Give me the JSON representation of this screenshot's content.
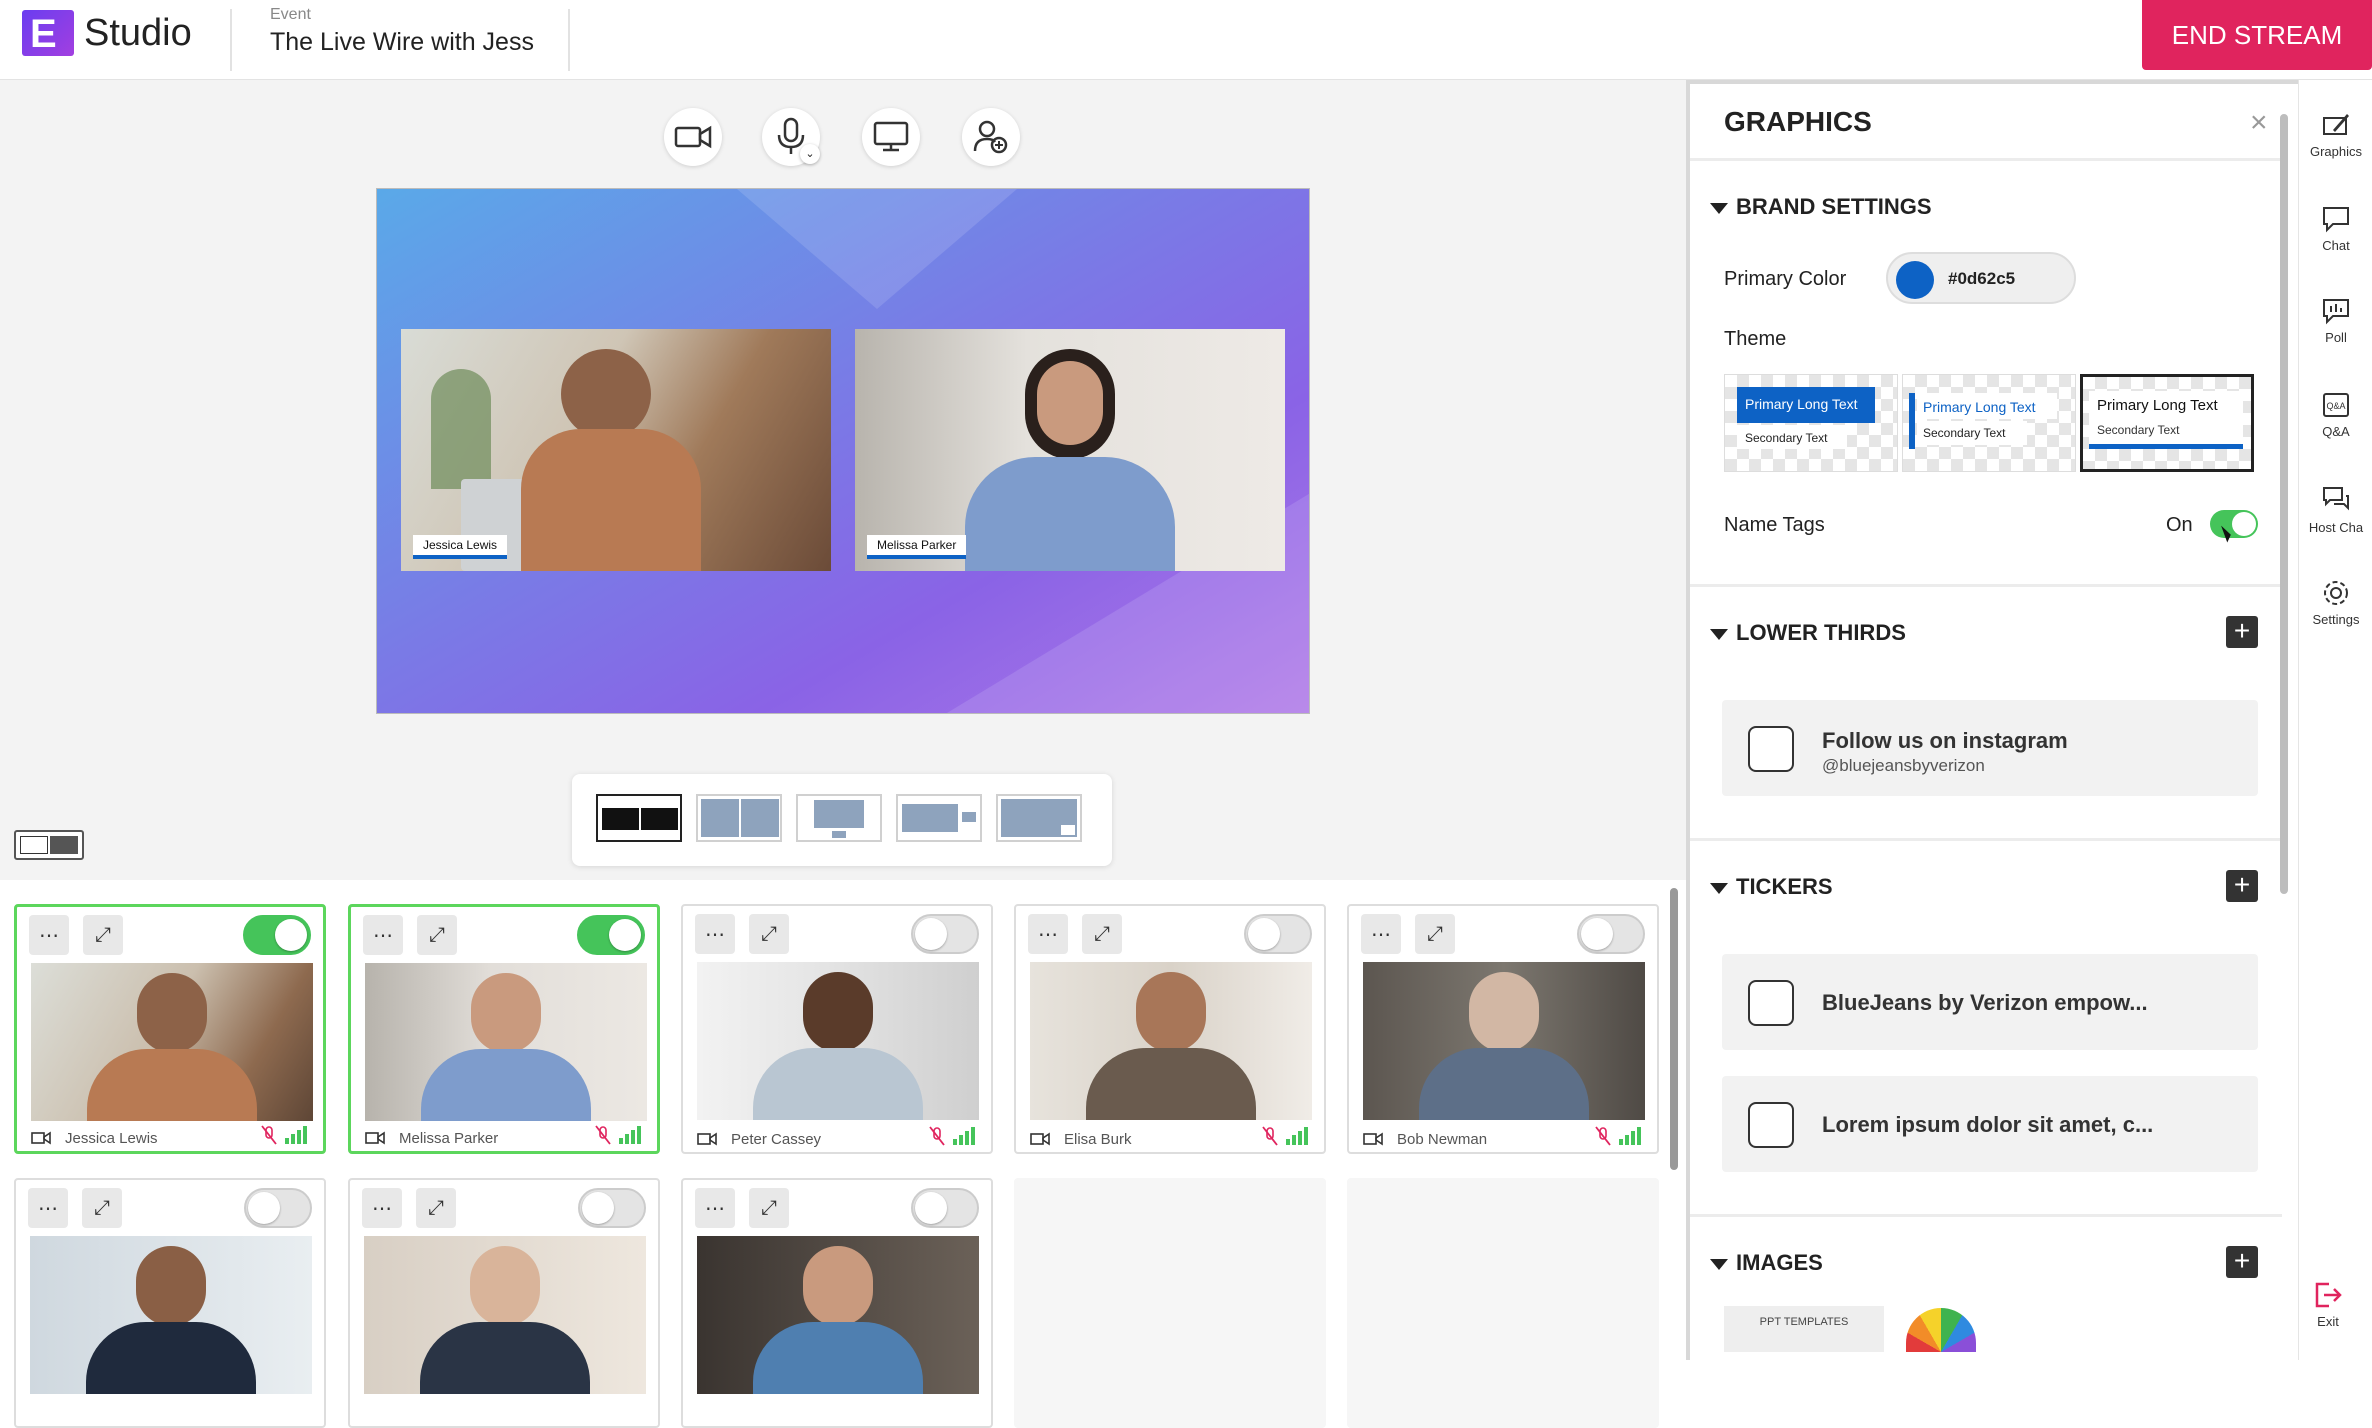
{
  "header": {
    "logo_letter": "E",
    "app_name": "Studio",
    "event_label": "Event",
    "event_title": "The Live Wire with Jess",
    "end_stream_label": "END STREAM"
  },
  "stage": {
    "name_tags": [
      "Jessica Lewis",
      "Melissa Parker"
    ]
  },
  "participants": [
    {
      "name": "Jessica Lewis",
      "live": true
    },
    {
      "name": "Melissa Parker",
      "live": true
    },
    {
      "name": "Peter Cassey",
      "live": false
    },
    {
      "name": "Elisa Burk",
      "live": false
    },
    {
      "name": "Bob Newman",
      "live": false
    }
  ],
  "graphics": {
    "title": "GRAPHICS",
    "close_icon": "×",
    "brand_settings": {
      "heading": "BRAND SETTINGS",
      "primary_color_label": "Primary Color",
      "primary_color_value": "#0d62c5",
      "theme_label": "Theme",
      "themes": [
        {
          "primary": "Primary Long Text",
          "secondary": "Secondary Text"
        },
        {
          "primary": "Primary Long Text",
          "secondary": "Secondary Text"
        },
        {
          "primary": "Primary Long Text",
          "secondary": "Secondary Text"
        }
      ],
      "name_tags_label": "Name Tags",
      "name_tags_state": "On"
    },
    "lower_thirds": {
      "heading": "LOWER THIRDS",
      "items": [
        {
          "title": "Follow us on instagram",
          "subtitle": "@bluejeansbyverizon"
        }
      ]
    },
    "tickers": {
      "heading": "TICKERS",
      "items": [
        {
          "title": "BlueJeans by Verizon empow..."
        },
        {
          "title": "Lorem ipsum dolor sit amet, c..."
        }
      ]
    },
    "images": {
      "heading": "IMAGES",
      "thumb_label": "PPT TEMPLATES"
    }
  },
  "rail": {
    "items": [
      "Graphics",
      "Chat",
      "Poll",
      "Q&A",
      "Host Cha",
      "Settings"
    ],
    "exit_label": "Exit"
  },
  "colors": {
    "accent_red": "#e0245e",
    "brand_blue": "#0d62c5",
    "live_green": "#45c45a"
  }
}
